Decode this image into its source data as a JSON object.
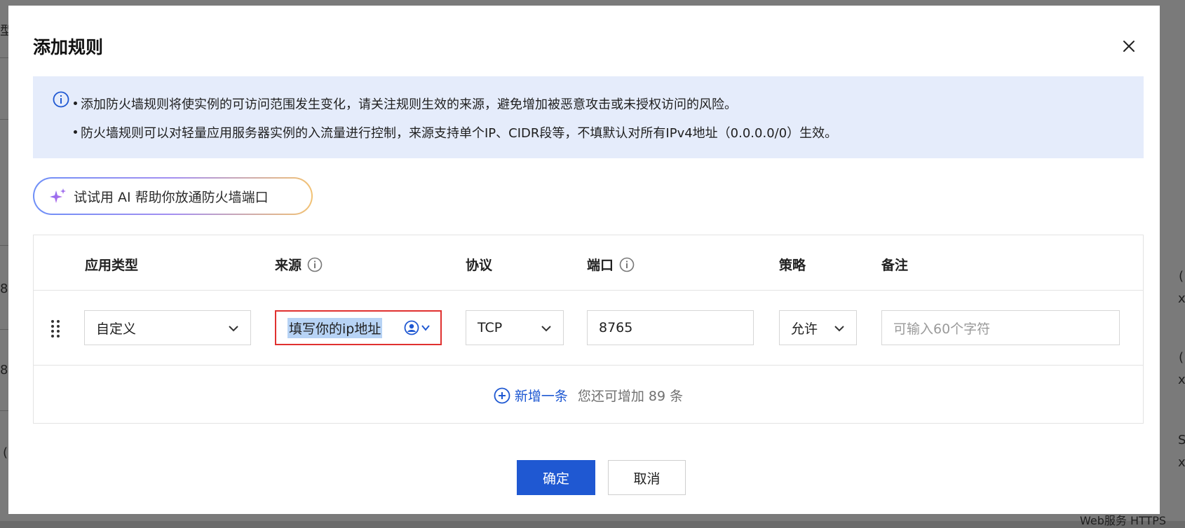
{
  "background": {
    "left_glyphs": [
      "型",
      "8",
      "8",
      "("
    ],
    "right_glyphs": [
      "(",
      "x",
      "(",
      "x",
      "S",
      "x"
    ],
    "bottom_right_text": "Web服务 HTTPS"
  },
  "dialog": {
    "title": "添加规则",
    "close_icon": "close-icon"
  },
  "notice": {
    "icon": "info-icon",
    "lines": [
      "添加防火墙规则将使实例的可访问范围发生变化，请关注规则生效的来源，避免增加被恶意攻击或未授权访问的风险。",
      "防火墙规则可以对轻量应用服务器实例的入流量进行控制，来源支持单个IP、CIDR段等，不填默认对所有IPv4地址（0.0.0.0/0）生效。"
    ]
  },
  "ai_button": {
    "icon": "sparkle-icon",
    "label": "试试用 AI 帮助你放通防火墙端口"
  },
  "table": {
    "headers": {
      "app_type": "应用类型",
      "source": "来源",
      "protocol": "协议",
      "port": "端口",
      "policy": "策略",
      "remark": "备注"
    },
    "row": {
      "app_type": "自定义",
      "source": "填写你的ip地址",
      "protocol": "TCP",
      "port": "8765",
      "policy": "允许",
      "remark_placeholder": "可输入60个字符"
    },
    "add_label": "新增一条",
    "add_hint": "您还可增加 89 条"
  },
  "footer": {
    "confirm_label": "确定",
    "cancel_label": "取消"
  },
  "colors": {
    "primary": "#1f58d2",
    "notice_bg": "#e5ecfb",
    "error_border": "#e0312f",
    "selection": "#b7d3f5"
  }
}
